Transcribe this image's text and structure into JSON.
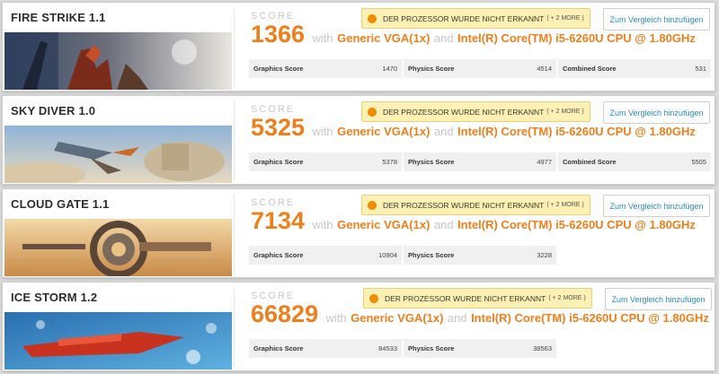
{
  "score_label": "SCORE",
  "with_text": "with",
  "and_text": "and",
  "warning": {
    "text": "DER PROZESSOR WURDE NICHT ERKANNT",
    "more": "( + 2 MORE )",
    "icon": "warning-icon",
    "color": "#f08c00"
  },
  "compare_label": "Zum Vergleich hinzufügen",
  "accent_color": "#ef7f1a",
  "benchmarks": [
    {
      "title": "FIRE STRIKE 1.1",
      "score": "1366",
      "gpu": "Generic VGA(1x)",
      "cpu": "Intel(R) Core(TM) i5-6260U CPU @ 1.80GHz",
      "subscores": [
        {
          "label": "Graphics Score",
          "value": "1470"
        },
        {
          "label": "Physics Score",
          "value": "4514"
        },
        {
          "label": "Combined Score",
          "value": "531"
        }
      ]
    },
    {
      "title": "SKY DIVER 1.0",
      "score": "5325",
      "gpu": "Generic VGA(1x)",
      "cpu": "Intel(R) Core(TM) i5-6260U CPU @ 1.80GHz",
      "subscores": [
        {
          "label": "Graphics Score",
          "value": "5378"
        },
        {
          "label": "Physics Score",
          "value": "4977"
        },
        {
          "label": "Combined Score",
          "value": "5505"
        }
      ]
    },
    {
      "title": "CLOUD GATE 1.1",
      "score": "7134",
      "gpu": "Generic VGA(1x)",
      "cpu": "Intel(R) Core(TM) i5-6260U CPU @ 1.80GHz",
      "subscores": [
        {
          "label": "Graphics Score",
          "value": "10904"
        },
        {
          "label": "Physics Score",
          "value": "3228"
        }
      ]
    },
    {
      "title": "ICE STORM 1.2",
      "score": "66829",
      "gpu": "Generic VGA(1x)",
      "cpu": "Intel(R) Core(TM) i5-6260U CPU @ 1.80GHz",
      "subscores": [
        {
          "label": "Graphics Score",
          "value": "84533"
        },
        {
          "label": "Physics Score",
          "value": "38563"
        }
      ]
    }
  ]
}
